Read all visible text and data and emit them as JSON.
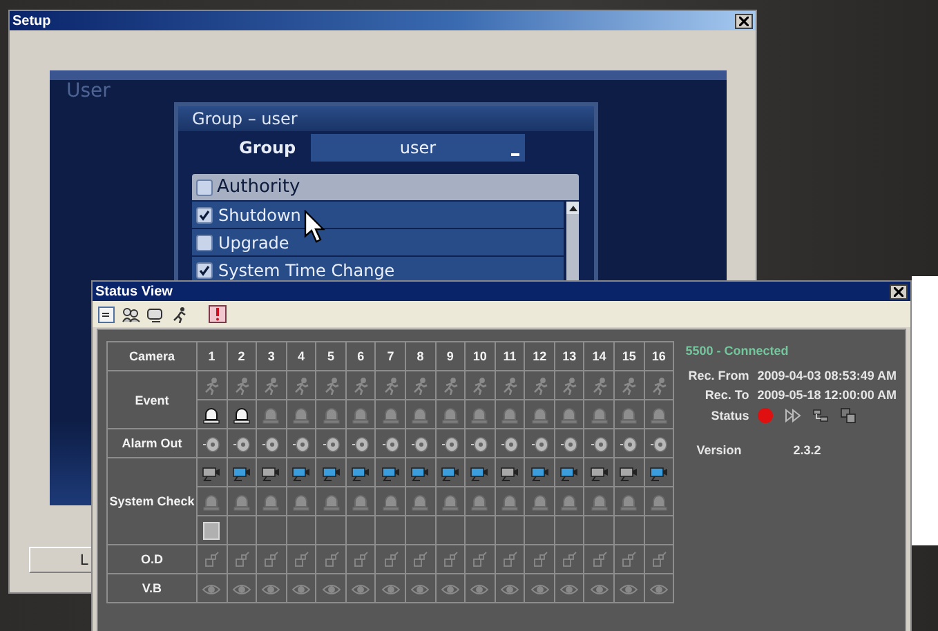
{
  "setup_window": {
    "title": "Setup",
    "panel_title": "User",
    "group_dialog": {
      "title": "Group – user",
      "field_label": "Group",
      "field_value": "user",
      "list_header": {
        "label": "Authority",
        "checked": false
      },
      "items": [
        {
          "label": "Shutdown",
          "checked": true
        },
        {
          "label": "Upgrade",
          "checked": false
        },
        {
          "label": "System Time Change",
          "checked": true
        }
      ]
    },
    "button": "L"
  },
  "status_window": {
    "title": "Status View",
    "table": {
      "corner": "Camera",
      "columns": [
        "1",
        "2",
        "3",
        "4",
        "5",
        "6",
        "7",
        "8",
        "9",
        "10",
        "11",
        "12",
        "13",
        "14",
        "15",
        "16"
      ],
      "groups": [
        {
          "label": "Event",
          "rows": [
            {
              "kind": "motion",
              "cells": [
                {
                  "active": false
                },
                {
                  "active": false
                },
                {
                  "active": false
                },
                {
                  "active": false
                },
                {
                  "active": false
                },
                {
                  "active": false
                },
                {
                  "active": false
                },
                {
                  "active": false
                },
                {
                  "active": false
                },
                {
                  "active": false
                },
                {
                  "active": false
                },
                {
                  "active": false
                },
                {
                  "active": false
                },
                {
                  "active": false
                },
                {
                  "active": false
                },
                {
                  "active": false
                }
              ]
            },
            {
              "kind": "sensor",
              "cells": [
                {
                  "active": true
                },
                {
                  "active": true
                },
                {
                  "active": false
                },
                {
                  "active": false
                },
                {
                  "active": false
                },
                {
                  "active": false
                },
                {
                  "active": false
                },
                {
                  "active": false
                },
                {
                  "active": false
                },
                {
                  "active": false
                },
                {
                  "active": false
                },
                {
                  "active": false
                },
                {
                  "active": false
                },
                {
                  "active": false
                },
                {
                  "active": false
                },
                {
                  "active": false
                }
              ]
            }
          ]
        },
        {
          "label": "Alarm Out",
          "rows": [
            {
              "kind": "alarm",
              "cells": [
                {
                  "active": false
                },
                {
                  "active": false
                },
                {
                  "active": false
                },
                {
                  "active": false
                },
                {
                  "active": false
                },
                {
                  "active": false
                },
                {
                  "active": false
                },
                {
                  "active": false
                },
                {
                  "active": false
                },
                {
                  "active": false
                },
                {
                  "active": false
                },
                {
                  "active": false
                },
                {
                  "active": false
                },
                {
                  "active": false
                },
                {
                  "active": false
                },
                {
                  "active": false
                }
              ]
            }
          ]
        },
        {
          "label": "System Check",
          "rows": [
            {
              "kind": "camera",
              "cells": [
                {
                  "active": false
                },
                {
                  "active": true
                },
                {
                  "active": false
                },
                {
                  "active": true
                },
                {
                  "active": true
                },
                {
                  "active": true
                },
                {
                  "active": true
                },
                {
                  "active": true
                },
                {
                  "active": true
                },
                {
                  "active": true
                },
                {
                  "active": false
                },
                {
                  "active": true
                },
                {
                  "active": true
                },
                {
                  "active": false
                },
                {
                  "active": false
                },
                {
                  "active": true
                }
              ]
            },
            {
              "kind": "sensor",
              "cells": [
                {
                  "active": false
                },
                {
                  "active": false
                },
                {
                  "active": false
                },
                {
                  "active": false
                },
                {
                  "active": false
                },
                {
                  "active": false
                },
                {
                  "active": false
                },
                {
                  "active": false
                },
                {
                  "active": false
                },
                {
                  "active": false
                },
                {
                  "active": false
                },
                {
                  "active": false
                },
                {
                  "active": false
                },
                {
                  "active": false
                },
                {
                  "active": false
                },
                {
                  "active": false
                }
              ]
            },
            {
              "kind": "disk",
              "cells": [
                {
                  "active": true
                },
                {
                  "active": false
                },
                {
                  "active": false
                },
                {
                  "active": false
                },
                {
                  "active": false
                },
                {
                  "active": false
                },
                {
                  "active": false
                },
                {
                  "active": false
                },
                {
                  "active": false
                },
                {
                  "active": false
                },
                {
                  "active": false
                },
                {
                  "active": false
                },
                {
                  "active": false
                },
                {
                  "active": false
                },
                {
                  "active": false
                },
                {
                  "active": false
                }
              ]
            }
          ]
        },
        {
          "label": "O.D",
          "rows": [
            {
              "kind": "object",
              "cells": [
                {
                  "active": false
                },
                {
                  "active": false
                },
                {
                  "active": false
                },
                {
                  "active": false
                },
                {
                  "active": false
                },
                {
                  "active": false
                },
                {
                  "active": false
                },
                {
                  "active": false
                },
                {
                  "active": false
                },
                {
                  "active": false
                },
                {
                  "active": false
                },
                {
                  "active": false
                },
                {
                  "active": false
                },
                {
                  "active": false
                },
                {
                  "active": false
                },
                {
                  "active": false
                }
              ]
            }
          ]
        },
        {
          "label": "V.B",
          "rows": [
            {
              "kind": "eye",
              "cells": [
                {
                  "active": false
                },
                {
                  "active": false
                },
                {
                  "active": false
                },
                {
                  "active": false
                },
                {
                  "active": false
                },
                {
                  "active": false
                },
                {
                  "active": false
                },
                {
                  "active": false
                },
                {
                  "active": false
                },
                {
                  "active": false
                },
                {
                  "active": false
                },
                {
                  "active": false
                },
                {
                  "active": false
                },
                {
                  "active": false
                },
                {
                  "active": false
                },
                {
                  "active": false
                }
              ]
            }
          ]
        }
      ]
    },
    "info": {
      "connection": "5500 - Connected",
      "rec_from": {
        "label": "Rec. From",
        "value": "2009-04-03 08:53:49 AM"
      },
      "rec_to": {
        "label": "Rec. To",
        "value": "2009-05-18 12:00:00 AM"
      },
      "status": {
        "label": "Status",
        "recording": true
      },
      "version": {
        "label": "Version",
        "value": "2.3.2"
      }
    }
  }
}
